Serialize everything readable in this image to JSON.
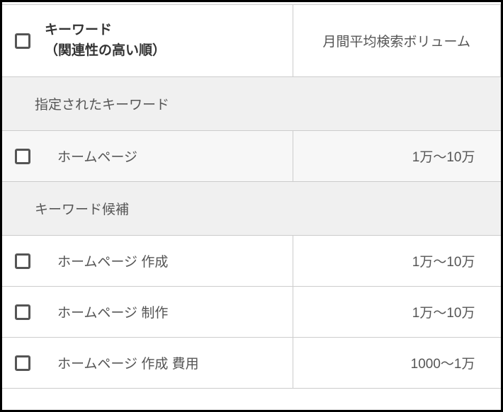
{
  "header": {
    "keyword_label_line1": "キーワード",
    "keyword_label_line2": "（関連性の高い順）",
    "volume_label": "月間平均検索ボリューム"
  },
  "sections": {
    "specified": "指定されたキーワード",
    "candidates": "キーワード候補"
  },
  "rows": {
    "specified": [
      {
        "keyword": "ホームページ",
        "volume": "1万～10万"
      }
    ],
    "candidates": [
      {
        "keyword": "ホームページ 作成",
        "volume": "1万～10万"
      },
      {
        "keyword": "ホームページ 制作",
        "volume": "1万～10万"
      },
      {
        "keyword": "ホームページ 作成 費用",
        "volume": "1000～1万"
      }
    ]
  }
}
